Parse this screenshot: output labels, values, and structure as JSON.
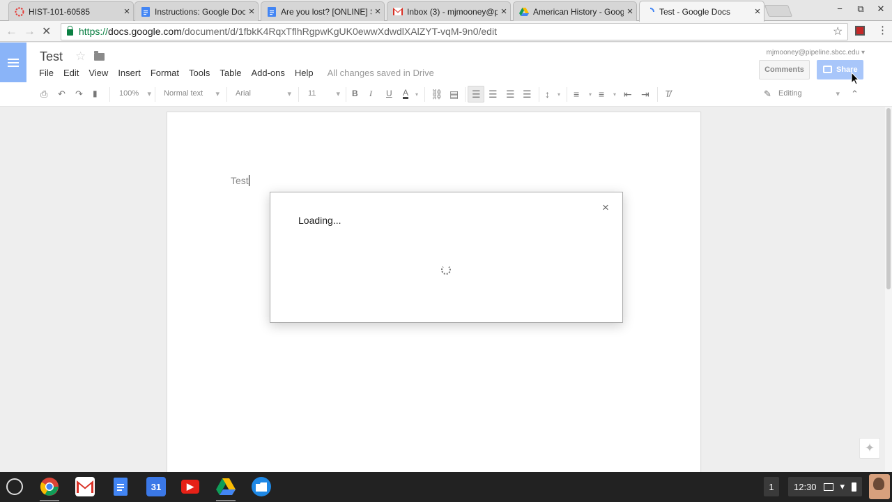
{
  "browser": {
    "tabs": [
      {
        "title": "HIST-101-60585",
        "favicon": "canvas-icon",
        "color": "#e53935"
      },
      {
        "title": "Instructions: Google Doc",
        "favicon": "google-docs-icon",
        "color": "#4285f4"
      },
      {
        "title": "Are you lost? [ONLINE] S",
        "favicon": "google-docs-icon",
        "color": "#4285f4"
      },
      {
        "title": "Inbox (3) - mjmooney@p",
        "favicon": "gmail-icon",
        "color": "#d93025"
      },
      {
        "title": "American History - Goog",
        "favicon": "google-drive-icon",
        "color": "#0f9d58"
      },
      {
        "title": "Test - Google Docs",
        "favicon": "loading-icon",
        "color": "#4285f4"
      }
    ],
    "close_glyph": "×",
    "window_controls": {
      "minimize": "−",
      "restore": "⧉",
      "close": "✕"
    },
    "url": {
      "scheme": "https://",
      "host": "docs.google.com",
      "path": "/document/d/1fbkK4RqxTflhRgpwKgUK0ewwXdwdlXAlZYT-vqM-9n0/edit"
    }
  },
  "docs": {
    "title": "Test",
    "menus": [
      "File",
      "Edit",
      "View",
      "Insert",
      "Format",
      "Tools",
      "Table",
      "Add-ons",
      "Help"
    ],
    "save_status": "All changes saved in Drive",
    "user_email": "mjmooney@pipeline.sbcc.edu",
    "comments_label": "Comments",
    "share_label": "Share",
    "accent": "#a8c6fa",
    "toolbar": {
      "zoom": "100%",
      "style": "Normal text",
      "font": "Arial",
      "size": "11",
      "bold": "B",
      "italic": "I",
      "underline": "U",
      "text_color": "A",
      "mode": "Editing"
    },
    "body_text": "Test"
  },
  "dialog": {
    "title": "Loading...",
    "close_glyph": "×"
  },
  "shelf": {
    "apps": [
      {
        "name": "chrome-icon"
      },
      {
        "name": "gmail-icon"
      },
      {
        "name": "google-docs-icon"
      },
      {
        "name": "calendar-icon",
        "label": "31"
      },
      {
        "name": "youtube-icon"
      },
      {
        "name": "google-drive-icon"
      },
      {
        "name": "files-icon"
      }
    ],
    "notification_count": "1",
    "time": "12:30"
  }
}
